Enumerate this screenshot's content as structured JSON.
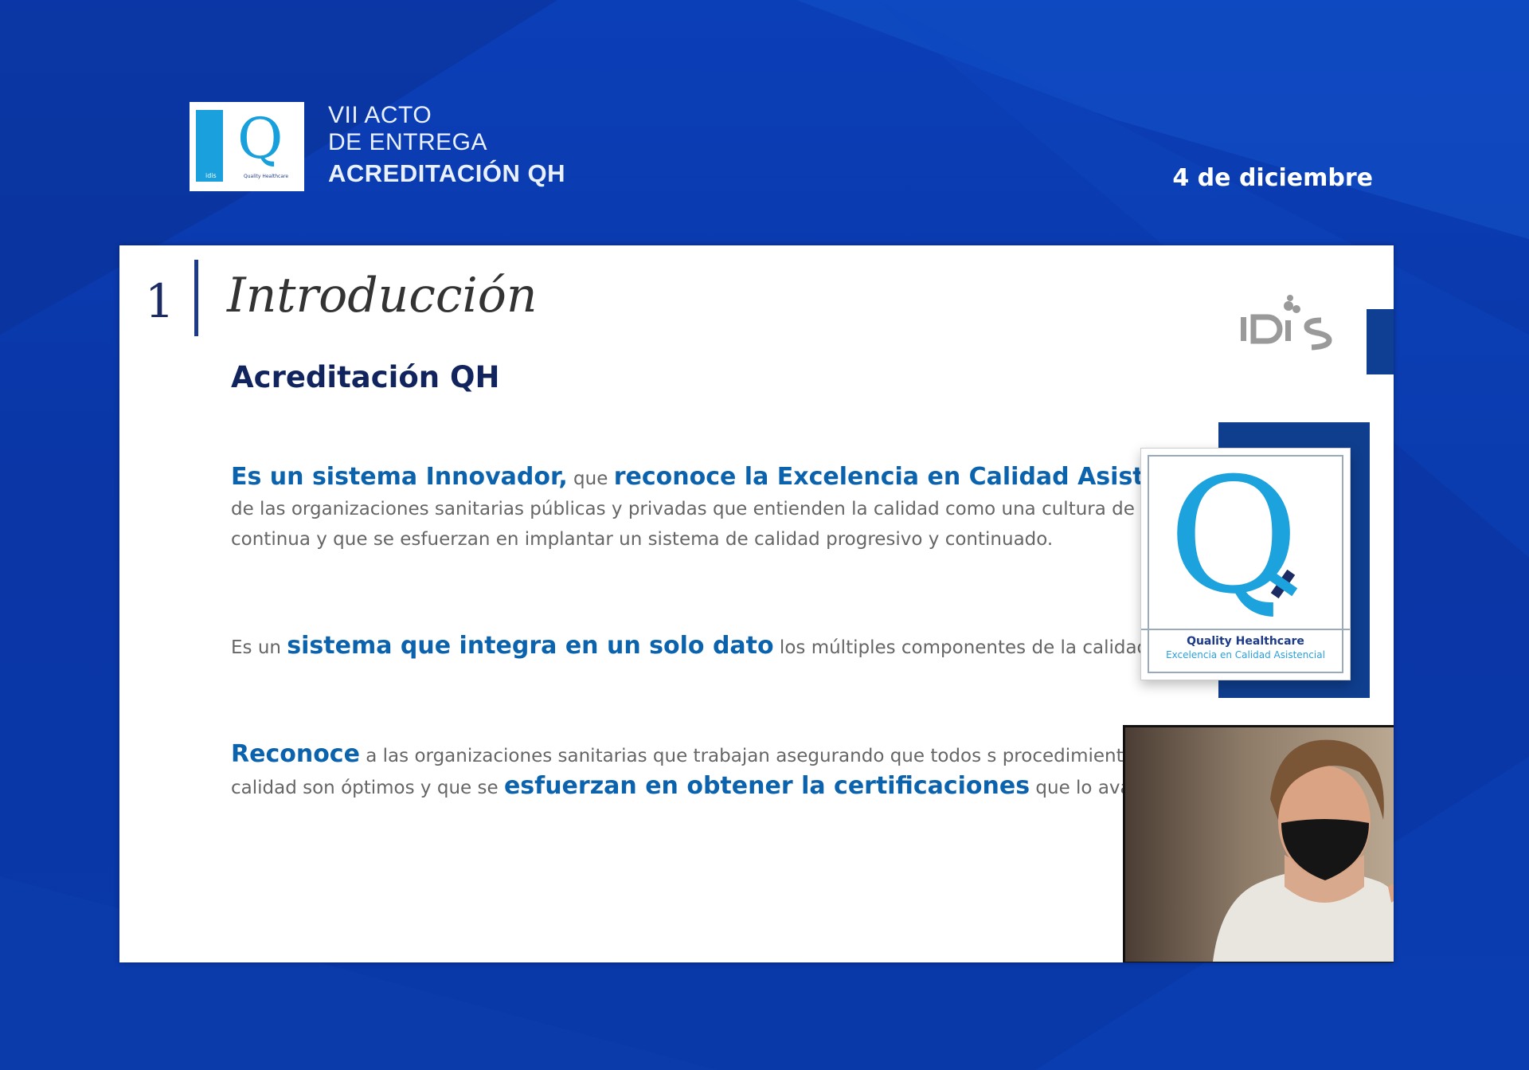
{
  "header": {
    "logo": {
      "bar_text": "idis",
      "letter": "Q",
      "tagline": "Quality Healthcare"
    },
    "event_line1": "VII ACTO",
    "event_line2": "DE ENTREGA",
    "event_line3": "ACREDITACIÓN QH",
    "date": "4 de diciembre"
  },
  "slide": {
    "section_number": "1",
    "section_title": "Introducción",
    "subtitle": "Acreditación QH",
    "paragraphs": [
      {
        "h1": "Es un sistema Innovador,",
        "t1": " que ",
        "h2": "reconoce la Excelencia en Calidad Asistencial",
        "t2": " de las organizaciones sanitarias públicas y privadas que entienden la calidad como una cultura de mejora continua y que se esfuerzan en implantar un sistema de calidad progresivo y continuado."
      },
      {
        "t1": "Es un ",
        "h1": "sistema que integra en un solo dato",
        "t2": " los múltiples componentes de la calidad."
      },
      {
        "h1": "Reconoce",
        "t1": " a las organizaciones sanitarias que trabajan asegurando que todos s procedimientos de calidad son óptimos y que se ",
        "h2": "esfuerzan en obtener la certificaciones",
        "t2": " que lo avalan."
      }
    ],
    "qh_card": {
      "letter": "Q",
      "line1": "Quality Healthcare",
      "line2": "Excelencia en Calidad Asistencial"
    }
  },
  "colors": {
    "background": "#0a3aa8",
    "slide_accent": "#0c63ad",
    "navy": "#12245e",
    "qh_cyan": "#1ca2dc"
  },
  "icons": {
    "idis_logo": "idis-logo",
    "qh_logo": "qh-logo",
    "webcam": "webcam-feed"
  }
}
